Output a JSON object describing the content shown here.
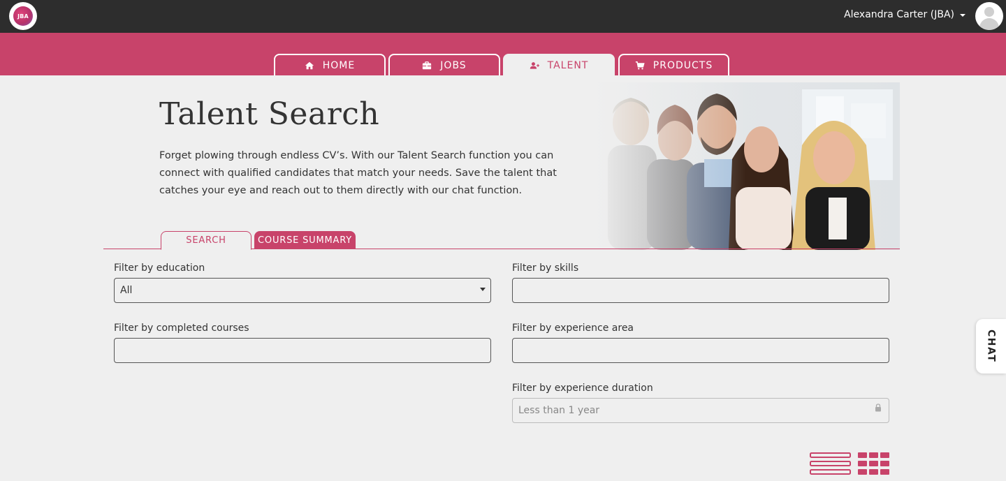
{
  "topbar": {
    "logo_text": "JBA",
    "user_name": "Alexandra Carter (JBA)"
  },
  "nav": {
    "tabs": [
      {
        "label": "HOME",
        "icon": "home-icon",
        "active": false
      },
      {
        "label": "JOBS",
        "icon": "briefcase-icon",
        "active": false
      },
      {
        "label": "TALENT",
        "icon": "user-plus-icon",
        "active": true
      },
      {
        "label": "PRODUCTS",
        "icon": "cart-icon",
        "active": false
      }
    ]
  },
  "hero": {
    "title": "Talent Search",
    "description": "Forget plowing through endless CV’s. With our Talent Search function you can connect with qualified candidates that match your needs. Save the talent that catches your eye and reach out to them directly with our chat function."
  },
  "subtabs": {
    "search": "SEARCH",
    "course_summary": "COURSE SUMMARY"
  },
  "filters": {
    "education": {
      "label": "Filter by education",
      "value": "All"
    },
    "courses": {
      "label": "Filter by completed courses",
      "value": ""
    },
    "skills": {
      "label": "Filter by skills",
      "value": ""
    },
    "experience_area": {
      "label": "Filter by experience area",
      "value": ""
    },
    "experience_duration": {
      "label": "Filter by experience duration",
      "placeholder": "Less than 1 year"
    }
  },
  "chat": {
    "label": "CHAT"
  },
  "colors": {
    "brand": "#c8436a",
    "topbar": "#2d2d2d",
    "background": "#efefef"
  }
}
